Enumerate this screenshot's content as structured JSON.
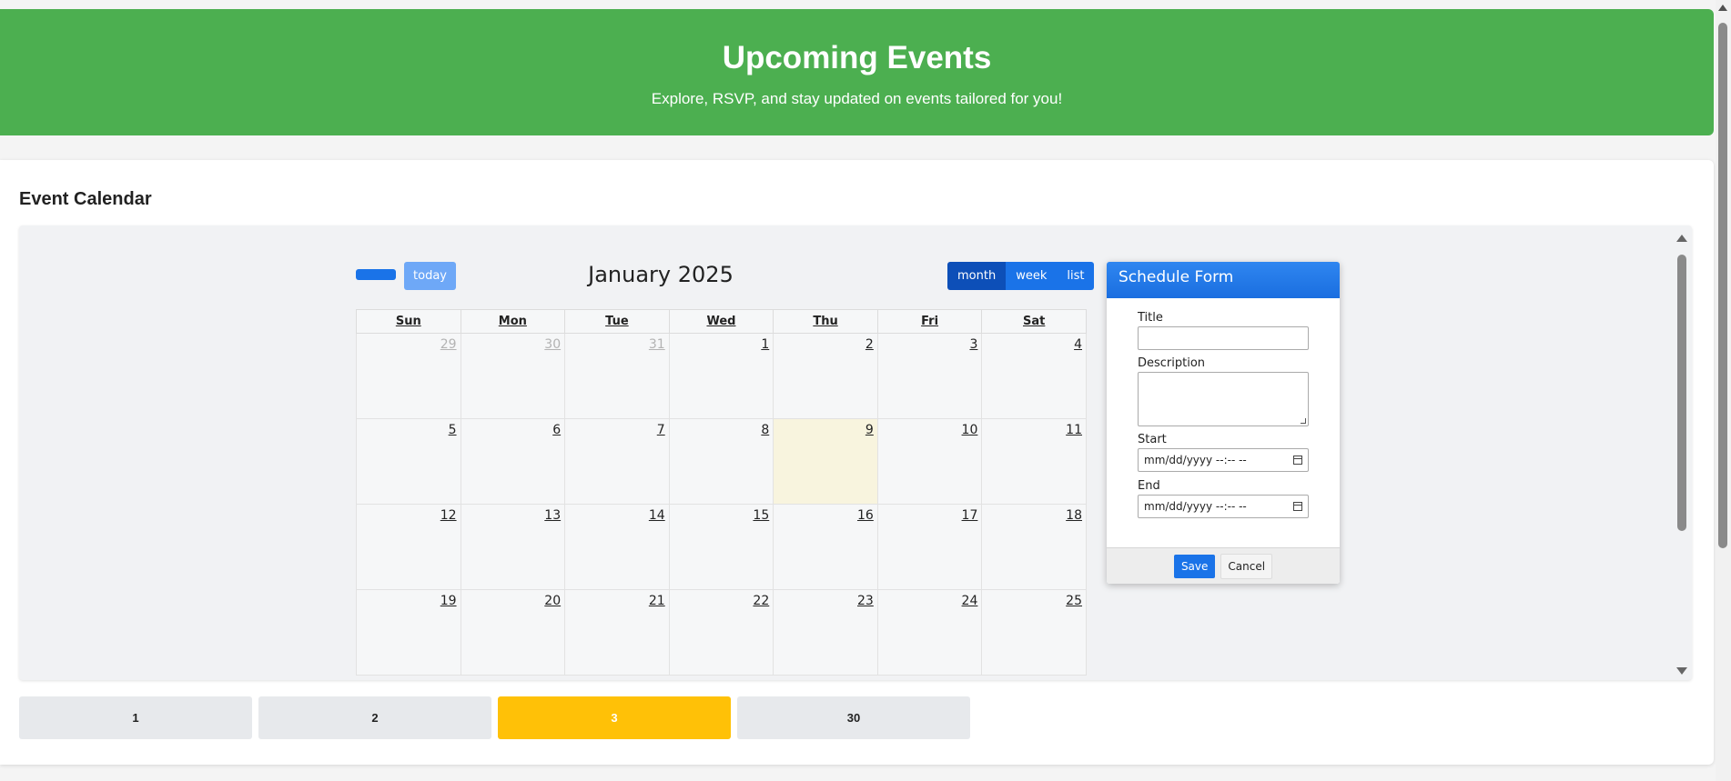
{
  "hero": {
    "title": "Upcoming Events",
    "subtitle": "Explore, RSVP, and stay updated on events tailored for you!",
    "color": "#4caf50"
  },
  "calendar_section": {
    "heading": "Event Calendar",
    "toolbar": {
      "today_label": "today",
      "title": "January 2025",
      "views": [
        {
          "label": "month",
          "active": true
        },
        {
          "label": "week",
          "active": false
        },
        {
          "label": "list",
          "active": false
        }
      ]
    },
    "weekdays": [
      "Sun",
      "Mon",
      "Tue",
      "Wed",
      "Thu",
      "Fri",
      "Sat"
    ],
    "weeks": [
      [
        "29",
        "30",
        "31",
        "1",
        "2",
        "3",
        "4"
      ],
      [
        "5",
        "6",
        "7",
        "8",
        "9",
        "10",
        "11"
      ],
      [
        "12",
        "13",
        "14",
        "15",
        "16",
        "17",
        "18"
      ],
      [
        "19",
        "20",
        "21",
        "22",
        "23",
        "24",
        "25"
      ]
    ],
    "today_date": "9",
    "other_month_days": [
      "29",
      "30",
      "31"
    ]
  },
  "schedule_form": {
    "title": "Schedule Form",
    "fields": {
      "title_label": "Title",
      "description_label": "Description",
      "start_label": "Start",
      "start_placeholder": "mm/dd/yyyy --:-- --",
      "end_label": "End",
      "end_placeholder": "mm/dd/yyyy --:-- --"
    },
    "save_label": "Save",
    "cancel_label": "Cancel"
  },
  "pagination": [
    {
      "label": "1",
      "active": false
    },
    {
      "label": "2",
      "active": false
    },
    {
      "label": "3",
      "active": true
    },
    {
      "label": "30",
      "active": false
    }
  ],
  "colors": {
    "accent_blue": "#1a73e8",
    "active_page": "#ffc107",
    "today_cell": "#f8f4de"
  }
}
